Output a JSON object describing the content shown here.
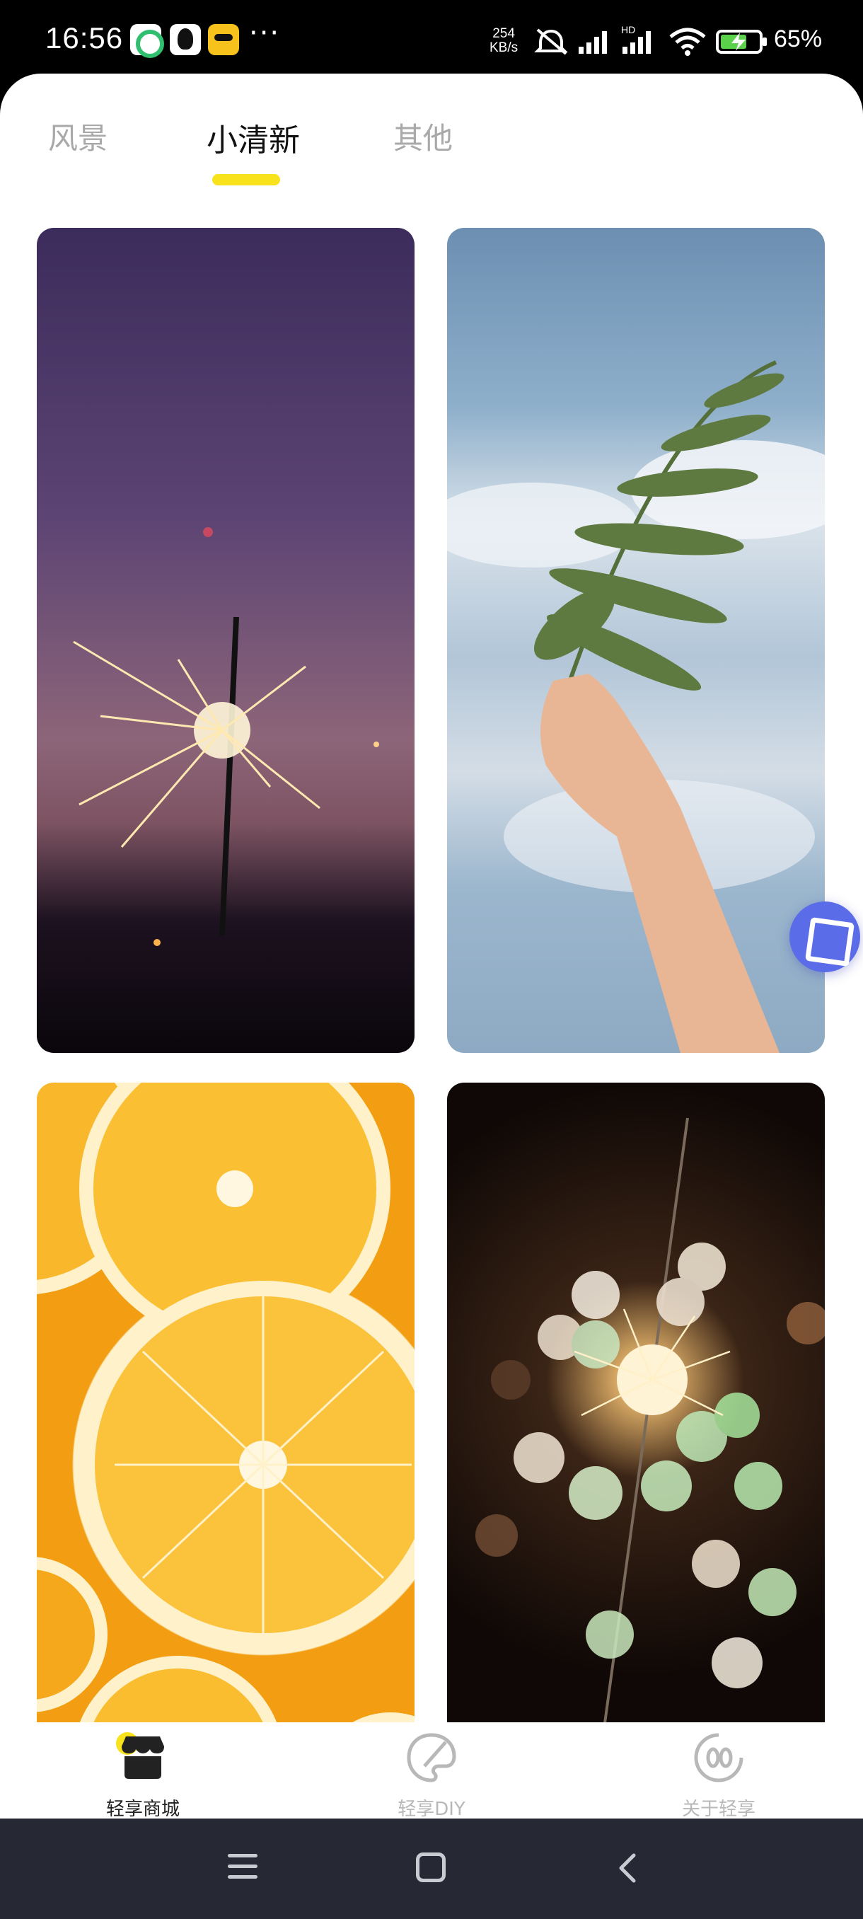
{
  "status_bar": {
    "time": "16:56",
    "more": "···",
    "net_speed_value": "254",
    "net_speed_unit": "KB/s",
    "network_label": "HD",
    "battery_percent": "65%"
  },
  "tabs": [
    {
      "label": "风景",
      "selected": false
    },
    {
      "label": "小清新",
      "selected": true
    },
    {
      "label": "其他",
      "selected": false
    }
  ],
  "wallpapers": [
    {
      "subject": "sparkler-dusk"
    },
    {
      "subject": "fern-in-hand-sky"
    },
    {
      "subject": "orange-slices"
    },
    {
      "subject": "sparkler-bokeh"
    }
  ],
  "bottom_nav": [
    {
      "label": "轻享商城",
      "icon": "shop-icon",
      "selected": true
    },
    {
      "label": "轻享DIY",
      "icon": "paint-palette-icon",
      "selected": false
    },
    {
      "label": "关于轻享",
      "icon": "about-face-icon",
      "selected": false
    }
  ],
  "colors": {
    "accent_yellow": "#f8e21b",
    "float_button": "#5a6ce8",
    "system_nav": "#262833"
  }
}
